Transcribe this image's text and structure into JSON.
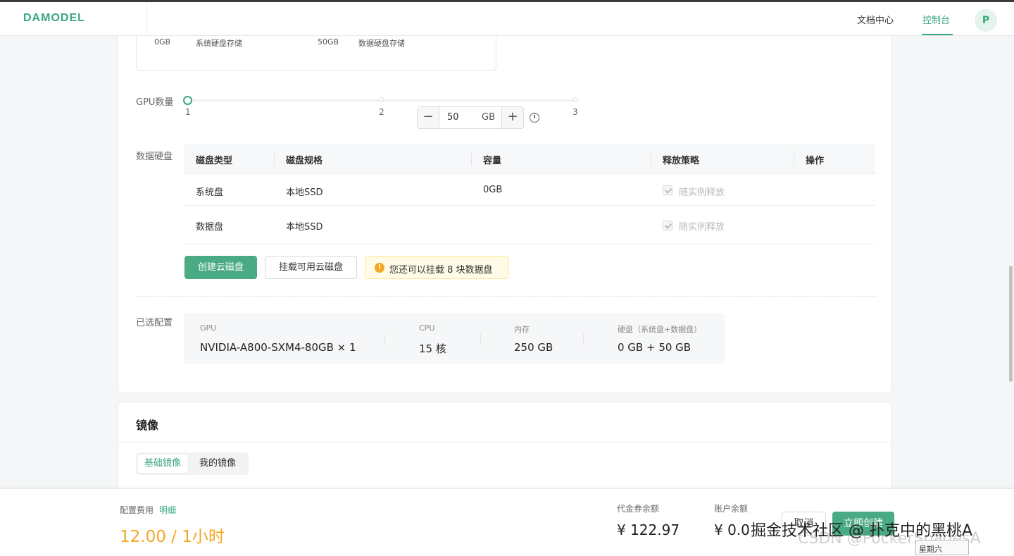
{
  "header": {
    "logo": "DAMODEL",
    "nav_docs": "文档中心",
    "nav_console": "控制台",
    "avatar_letter": "P"
  },
  "storage_summary": {
    "system_value": "0GB",
    "system_label": "系统硬盘存储",
    "data_value": "50GB",
    "data_label": "数据硬盘存储"
  },
  "gpu_count": {
    "label": "GPU数量",
    "marks": [
      "1",
      "2",
      "3"
    ],
    "selected": 1
  },
  "data_disk": {
    "label": "数据硬盘",
    "columns": [
      "磁盘类型",
      "磁盘规格",
      "容量",
      "释放策略",
      "操作"
    ],
    "rows": [
      {
        "type": "系统盘",
        "spec": "本地SSD",
        "capacity": "0GB",
        "release": "随实例释放",
        "checked": true
      },
      {
        "type": "数据盘",
        "spec": "本地SSD",
        "capacity_value": "50",
        "capacity_unit": "GB",
        "release": "随实例释放",
        "checked": true
      }
    ],
    "create_button": "创建云磁盘",
    "mount_button": "挂载可用云磁盘",
    "notice": "您还可以挂载 8 块数据盘"
  },
  "selected_config": {
    "label": "已选配置",
    "items": [
      {
        "key": "GPU",
        "value": "NVIDIA-A800-SXM4-80GB × 1"
      },
      {
        "key": "CPU",
        "value": "15 核"
      },
      {
        "key": "内存",
        "value": "250 GB"
      },
      {
        "key": "硬盘（系统盘+数据盘）",
        "value": "0 GB + 50 GB"
      }
    ]
  },
  "image_section": {
    "title": "镜像",
    "tabs": [
      "基础镜像",
      "我的镜像"
    ],
    "active_tab": "基础镜像"
  },
  "footer": {
    "fee_label": "配置费用",
    "fee_detail": "明细",
    "fee_price": "12.00 / 1小时",
    "voucher_label": "代金券余额",
    "voucher_value": "¥ 122.97",
    "account_label": "账户余额",
    "account_value": "¥ 0.0",
    "cancel_button": "取消",
    "create_button": "立即创建",
    "watermark_cn": "掘金技术社区 @ 扑克中的黑桃A",
    "watermark_csdn": "CSDN @PockerSpadesA",
    "tooltip": "星期六"
  },
  "colors": {
    "accent": "#3aa77d",
    "button_green": "#4aaa84",
    "price_orange": "#f5a623",
    "warning_bg": "#fffbe6"
  }
}
